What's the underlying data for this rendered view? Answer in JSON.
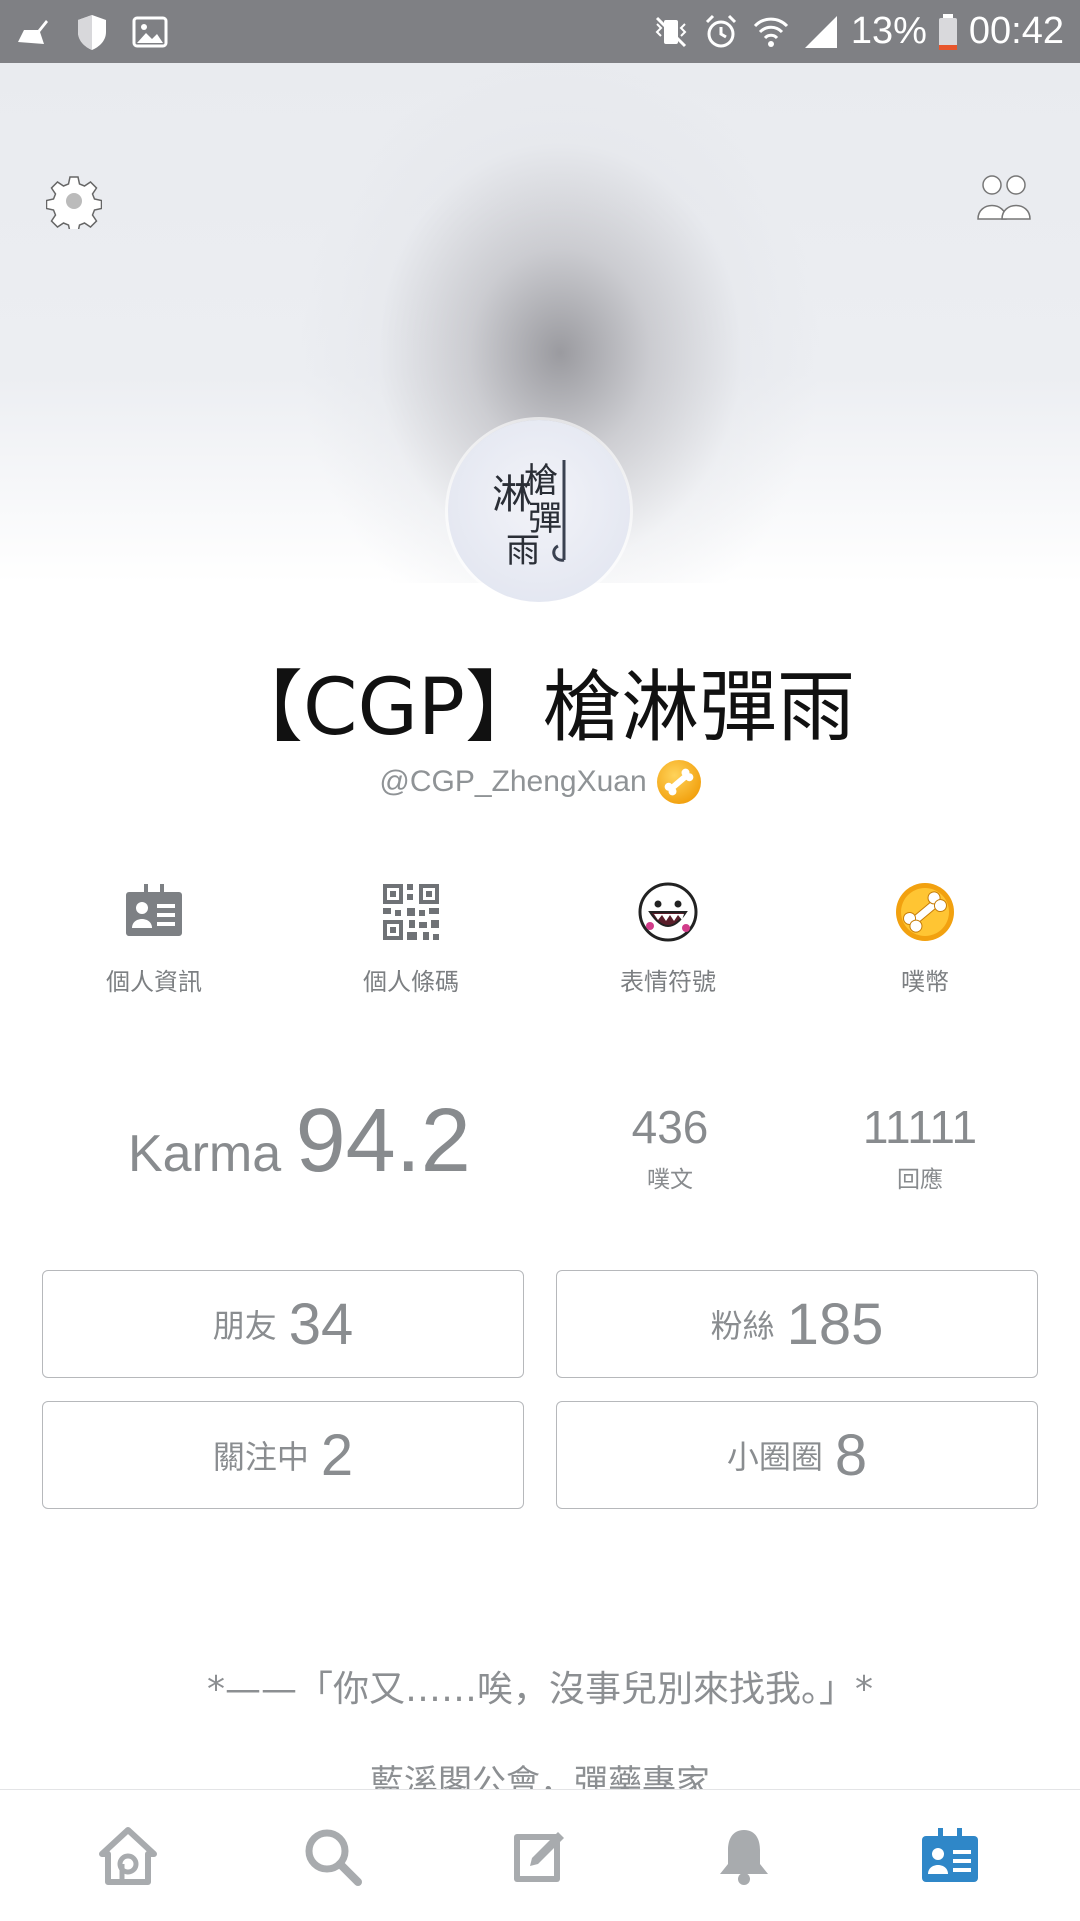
{
  "status_bar": {
    "battery": "13%",
    "time": "00:42",
    "icons": [
      "cleaner-icon",
      "shield-icon",
      "image-icon",
      "mute-vibrate-icon",
      "alarm-icon",
      "wifi-icon",
      "signal-icon",
      "battery-icon"
    ]
  },
  "header": {
    "settings_icon": "gear-icon",
    "friends_icon": "people-icon"
  },
  "profile": {
    "display_name": "【CGP】槍淋彈雨",
    "handle": "@CGP_ZhengXuan",
    "avatar_desc": "avatar"
  },
  "actions": [
    {
      "label": "個人資訊",
      "icon": "id-card-icon"
    },
    {
      "label": "個人條碼",
      "icon": "qr-code-icon"
    },
    {
      "label": "表情符號",
      "icon": "emoji-icon"
    },
    {
      "label": "噗幣",
      "icon": "plurk-coin-icon"
    }
  ],
  "stats": {
    "karma_label": "Karma",
    "karma_value": "94.2",
    "plurks": {
      "value": "436",
      "label": "噗文"
    },
    "responses": {
      "value": "11111",
      "label": "回應"
    }
  },
  "counts": {
    "friends": {
      "label": "朋友",
      "value": "34"
    },
    "fans": {
      "label": "粉絲",
      "value": "185"
    },
    "following": {
      "label": "關注中",
      "value": "2"
    },
    "cliques": {
      "label": "小圈圈",
      "value": "8"
    }
  },
  "bio": {
    "line1": "*——「你又……唉，沒事兒別來找我。」*",
    "line2": "藍溪閣公會，彈藥專家"
  },
  "bottom_nav": [
    {
      "name": "home",
      "icon": "home-icon"
    },
    {
      "name": "search",
      "icon": "search-icon"
    },
    {
      "name": "compose",
      "icon": "compose-icon"
    },
    {
      "name": "notifications",
      "icon": "bell-icon"
    },
    {
      "name": "profile",
      "icon": "profile-card-icon",
      "active": true
    }
  ],
  "colors": {
    "status_bar": "#7f8084",
    "text_gray": "#8a8d90",
    "icon_gray": "#a8abae",
    "accent": "#2f87c8",
    "coin": "#f2a10f"
  }
}
